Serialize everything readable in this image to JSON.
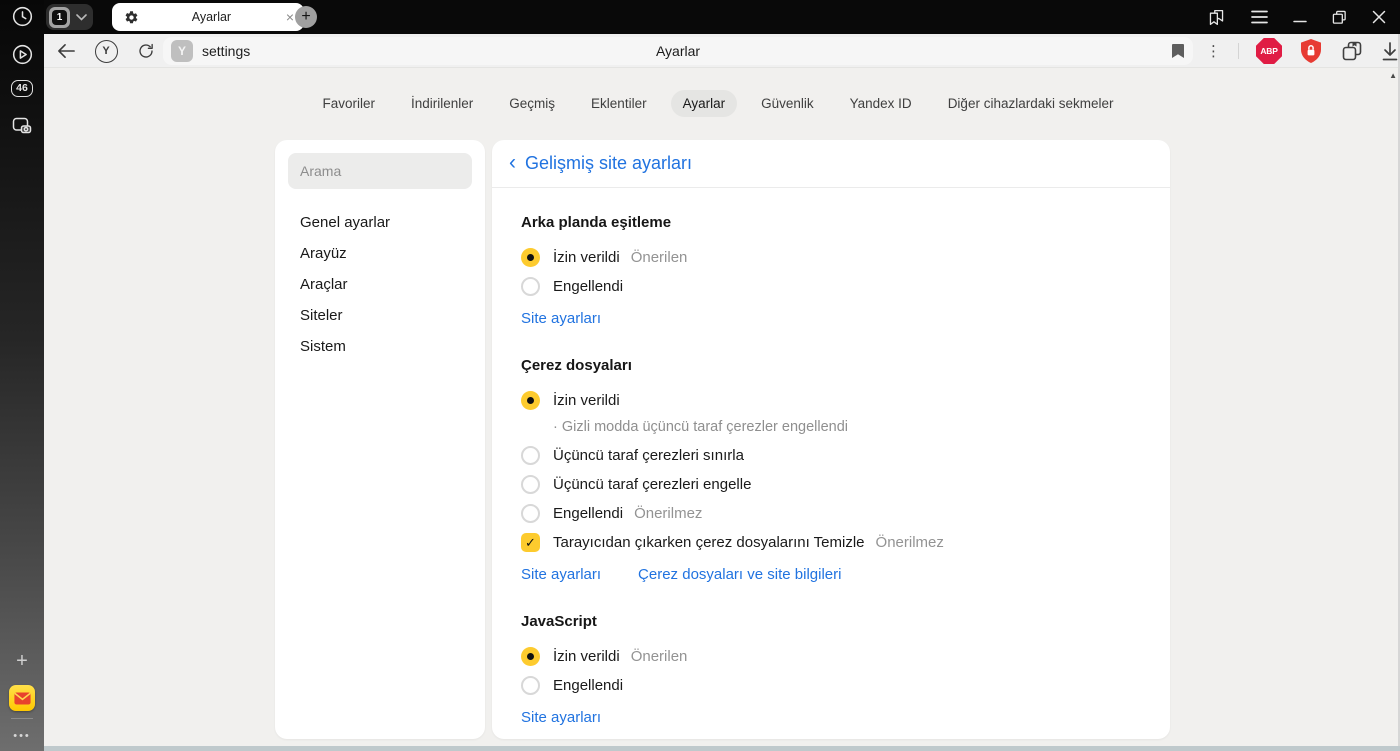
{
  "tab_strip": {
    "tab_counter": "1",
    "active_tab_title": "Ayarlar"
  },
  "toolbar": {
    "url": "settings",
    "page_title": "Ayarlar",
    "favicon_letter": "Y",
    "yandex_letter": "Y"
  },
  "left_rail": {
    "tab_count_badge": "46"
  },
  "extensions": {
    "abp_label": "ABP"
  },
  "nav": {
    "tabs": [
      {
        "label": "Favoriler"
      },
      {
        "label": "İndirilenler"
      },
      {
        "label": "Geçmiş"
      },
      {
        "label": "Eklentiler"
      },
      {
        "label": "Ayarlar"
      },
      {
        "label": "Güvenlik"
      },
      {
        "label": "Yandex ID"
      },
      {
        "label": "Diğer cihazlardaki sekmeler"
      }
    ],
    "active": "Ayarlar"
  },
  "sidebar": {
    "search_placeholder": "Arama",
    "items": [
      {
        "label": "Genel ayarlar"
      },
      {
        "label": "Arayüz"
      },
      {
        "label": "Araçlar"
      },
      {
        "label": "Siteler"
      },
      {
        "label": "Sistem"
      }
    ]
  },
  "content": {
    "header": {
      "title": "Gelişmiş site ayarları"
    },
    "sections": [
      {
        "title": "Arka planda eşitleme",
        "options": [
          {
            "label": "İzin verildi",
            "badge": "Önerilen",
            "selected": true
          },
          {
            "label": "Engellendi",
            "selected": false
          }
        ],
        "links": [
          "Site ayarları"
        ]
      },
      {
        "title": "Çerez dosyaları",
        "options": [
          {
            "label": "İzin verildi",
            "selected": true,
            "note": "Gizli modda üçüncü taraf çerezler engellendi"
          },
          {
            "label": "Üçüncü taraf çerezleri sınırla",
            "selected": false
          },
          {
            "label": "Üçüncü taraf çerezleri engelle",
            "selected": false
          },
          {
            "label": "Engellendi",
            "badge": "Önerilmez",
            "selected": false
          }
        ],
        "checkbox": {
          "label": "Tarayıcıdan çıkarken çerez dosyalarını Temizle",
          "badge": "Önerilmez",
          "checked": true
        },
        "links": [
          "Site ayarları",
          "Çerez dosyaları ve site bilgileri"
        ]
      },
      {
        "title": "JavaScript",
        "options": [
          {
            "label": "İzin verildi",
            "badge": "Önerilen",
            "selected": true
          },
          {
            "label": "Engellendi",
            "selected": false
          }
        ],
        "links": [
          "Site ayarları"
        ]
      }
    ]
  },
  "icons": {
    "back_chevron": "‹",
    "kebab": "⋮",
    "plus": "+",
    "close": "×",
    "more_dots": "•••",
    "bullet": "·",
    "check": "✓",
    "scroll_up": "▲"
  },
  "colors": {
    "accent_blue": "#2173e0",
    "yandex_yellow": "#fdcb2e",
    "abp_red": "#e01c44",
    "shield_red": "#e73b33"
  }
}
